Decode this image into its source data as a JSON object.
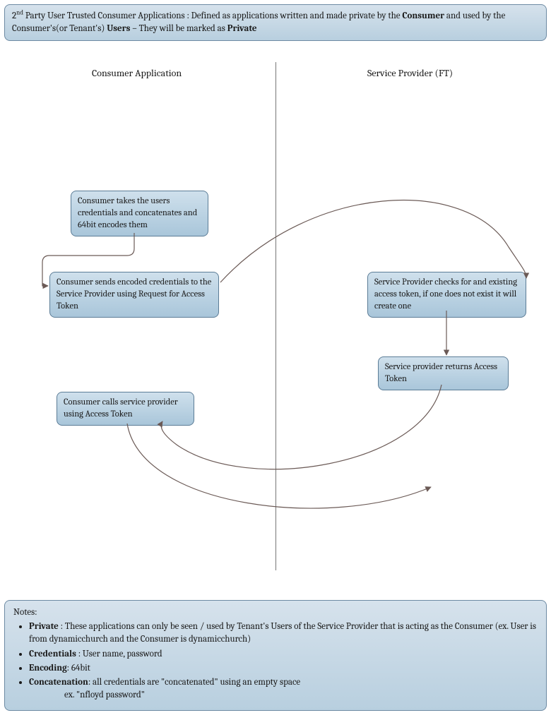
{
  "header": {
    "sup": "nd",
    "prefix": "2",
    "text1": " Party User Trusted Consumer Applications : Defined as applications written and made private by the ",
    "bold1": "Consumer",
    "text2": " and used by the Consumer's(or Tenant's) ",
    "bold2": "Users",
    "text3": " – They will be marked as ",
    "bold3": "Private"
  },
  "columns": {
    "left": "Consumer Application",
    "right": "Service Provider (FT)"
  },
  "nodes": {
    "n1": "Consumer takes the users credentials and concatenates and 64bit encodes them",
    "n2": "Consumer sends encoded credentials to the Service Provider using Request for Access Token",
    "n3": "Service Provider checks for and existing access token, if one does not exist it will create one",
    "n4": "Service provider returns Access Token",
    "n5": "Consumer calls service provider using Access Token"
  },
  "notes": {
    "title": "Notes:",
    "items": [
      {
        "term": "Private",
        "text": " : These applications can only be seen / used by Tenant's Users of the Service Provider that is acting as the Consumer (ex. User is from dynamicchurch and the Consumer is dynamicchurch)"
      },
      {
        "term": "Credentials",
        "text": " : User name, password"
      },
      {
        "term": "Encoding",
        "text": ": 64bit"
      },
      {
        "term": "Concatenation",
        "text": ": all credentials are \"concatenated\" using an empty space"
      }
    ],
    "example": "ex. \"nfloyd password\""
  }
}
